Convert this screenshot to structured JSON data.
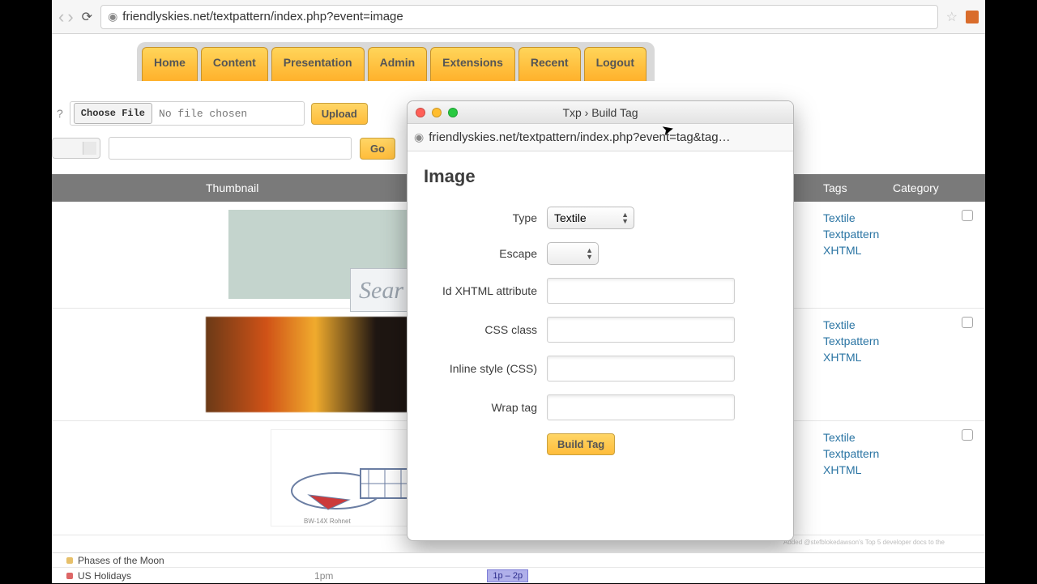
{
  "browser": {
    "url": "friendlyskies.net/textpattern/index.php?event=image"
  },
  "nav": {
    "tabs": [
      "Home",
      "Content",
      "Presentation",
      "Admin",
      "Extensions",
      "Recent",
      "Logout"
    ]
  },
  "upload": {
    "q": "?",
    "choose": "Choose File",
    "nofile": "No file chosen",
    "upload": "Upload",
    "go": "Go"
  },
  "table": {
    "head": {
      "thumb": "Thumbnail",
      "tags": "Tags",
      "cat": "Category"
    },
    "thumb1_search": "Sear",
    "tag_links": [
      "Textile",
      "Textpattern",
      "XHTML"
    ]
  },
  "popup": {
    "title": "Txp › Build Tag",
    "url": "friendlyskies.net/textpattern/index.php?event=tag&tag…",
    "heading": "Image",
    "labels": {
      "type": "Type",
      "escape": "Escape",
      "idattr": "Id XHTML attribute",
      "css": "CSS class",
      "inline": "Inline style (CSS)",
      "wrap": "Wrap tag"
    },
    "type_value": "Textile",
    "build": "Build Tag"
  },
  "calendar": {
    "item1": "Phases of the Moon",
    "item2": "US Holidays",
    "time": "1pm",
    "event": "1p – 2p"
  },
  "tiny": "Added @stefblokedawson's Top 5 developer docs to the"
}
